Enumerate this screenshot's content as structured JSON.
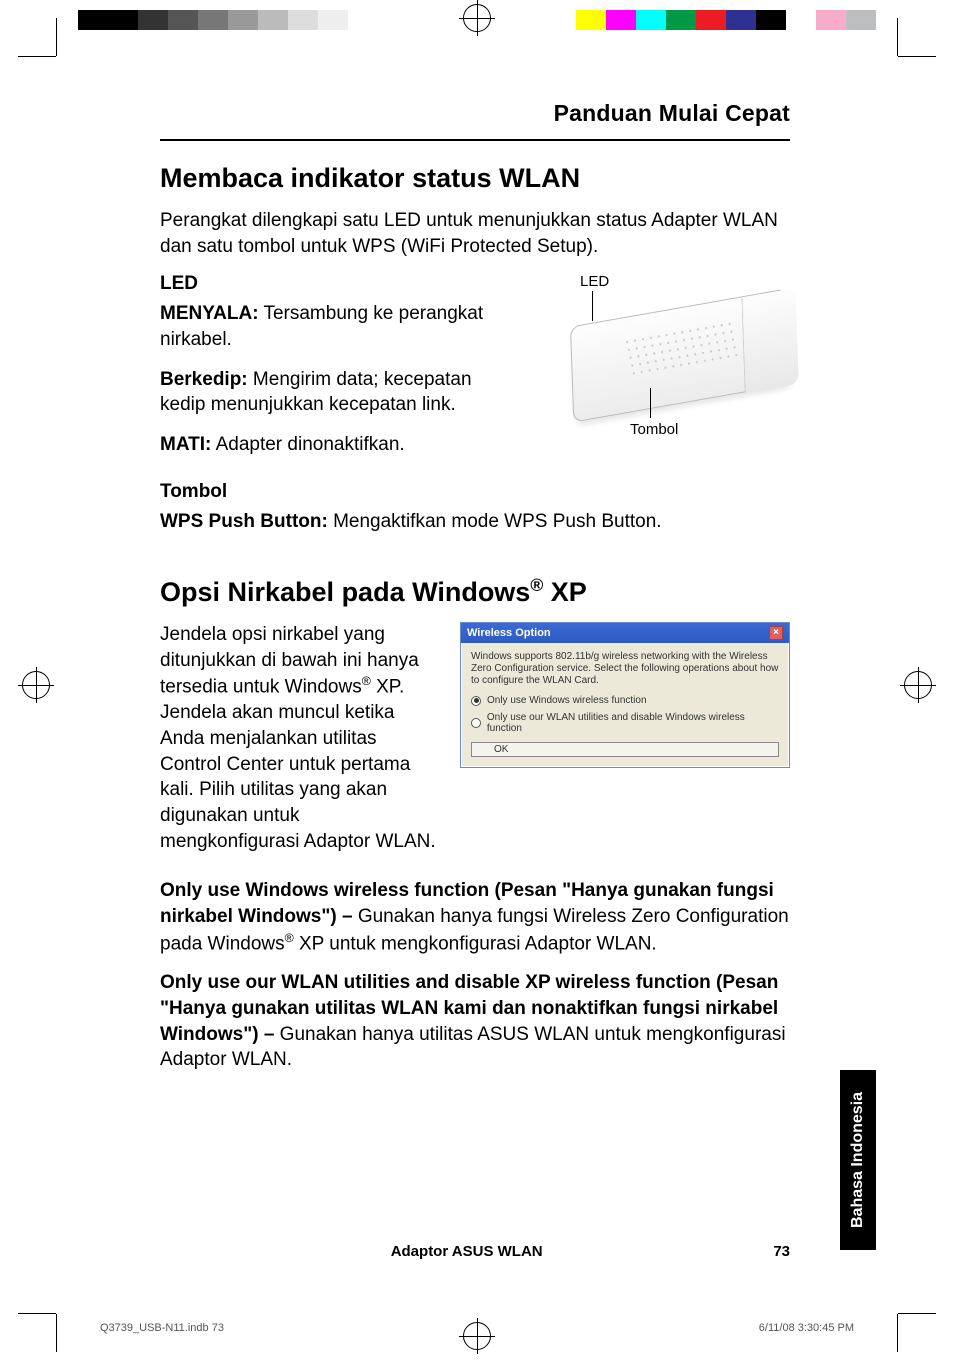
{
  "guide_title": "Panduan Mulai Cepat",
  "h1_a": "Membaca indikator status WLAN",
  "intro_a": "Perangkat dilengkapi satu LED untuk menunjukkan status Adapter WLAN dan satu tombol untuk WPS (WiFi Protected Setup).",
  "led": {
    "heading": "LED",
    "on_label": "MENYALA:",
    "on_text": " Tersambung ke perangkat nirkabel.",
    "blink_label": "Berkedip:",
    "blink_text": " Mengirim data; kecepatan kedip menunjukkan kecepatan link.",
    "off_label": "MATI:",
    "off_text": " Adapter dinonaktifkan."
  },
  "callouts": {
    "led": "LED",
    "button": "Tombol"
  },
  "button": {
    "heading": "Tombol",
    "wps_label": "WPS Push Button:",
    "wps_text": " Mengaktifkan mode WPS Push Button."
  },
  "h1_b_pre": "Opsi Nirkabel pada Windows",
  "h1_b_suf": " XP",
  "reg": "®",
  "intro_b_pre": "Jendela opsi nirkabel yang ditunjukkan di bawah ini hanya tersedia untuk Windows",
  "intro_b_suf": " XP. Jendela akan muncul ketika Anda menjalankan utilitas Control Center untuk pertama kali. Pilih utilitas yang akan digunakan untuk mengkonfigurasi Adaptor WLAN.",
  "dialog": {
    "title": "Wireless Option",
    "desc": "Windows supports 802.11b/g wireless networking with the Wireless Zero Configuration service. Select the following operations about how to configure the WLAN Card.",
    "opt1": "Only use Windows wireless function",
    "opt2": "Only use our WLAN utilities and disable Windows wireless function",
    "ok": "OK"
  },
  "opt1": {
    "bold": "Only use Windows wireless function (Pesan \"Hanya gunakan fungsi nirkabel Windows\") – ",
    "text_pre": "Gunakan hanya fungsi Wireless Zero Configuration pada Windows",
    "text_suf": " XP untuk mengkonfigurasi Adaptor WLAN."
  },
  "opt2": {
    "bold": "Only use our WLAN utilities and disable XP wireless function (Pesan \"Hanya gunakan utilitas WLAN kami dan nonaktifkan fungsi nirkabel Windows\") – ",
    "text": "Gunakan hanya utilitas ASUS WLAN untuk mengkonfigurasi Adaptor WLAN."
  },
  "side_tab": "Bahasa Indonesia",
  "footer_center": "Adaptor ASUS WLAN",
  "footer_page": "73",
  "print_footer_left": "Q3739_USB-N11.indb   73",
  "print_footer_right": "6/11/08   3:30:45 PM",
  "colors": {
    "grays": [
      "#000000",
      "#000000",
      "#333333",
      "#555555",
      "#777777",
      "#999999",
      "#bbbbbb",
      "#dddddd",
      "#eeeeee",
      "#ffffff"
    ],
    "cmyk": [
      "#ffff00",
      "#ff00ff",
      "#00ffff",
      "#009944",
      "#ed1c24",
      "#2e3192",
      "#000000",
      "#ffffff",
      "#f7adc9",
      "#bcbec0"
    ]
  }
}
